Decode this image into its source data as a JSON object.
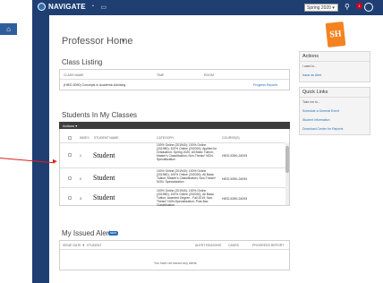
{
  "topbar": {
    "brand": "NAVIGATE",
    "icons": [
      "home-outline-icon",
      "bell-outline-icon",
      "document-outline-icon"
    ],
    "term_select": "Spring 2020",
    "notification_count": "1"
  },
  "sidebar": {
    "icons": [
      "home-icon",
      "mail-icon",
      "calendar-icon",
      "reports-icon",
      "chart-icon",
      "pin-icon",
      "search-icon",
      "tag-icon",
      "list-icon",
      "settings-icon"
    ]
  },
  "header": {
    "title": "Professor Home",
    "caret": "▾"
  },
  "logo_text": "SH",
  "class_listing": {
    "title": "Class Listing",
    "columns": [
      "CLASS NAME",
      "TIME",
      "ROOM"
    ],
    "rows": [
      {
        "class_name": "(HIED-5390) Concepts in Academic Advising",
        "time": "",
        "room": "",
        "action": "Progress Reports"
      }
    ]
  },
  "students": {
    "title": "Students In My Classes",
    "actions_label": "Actions ▾",
    "columns": [
      "INDEX",
      "STUDENT NAME",
      "CATEGORY",
      "COURSE(S)"
    ],
    "rows": [
      {
        "index": "1",
        "name": "Student",
        "category": "100% Online (201940); 100% Online (201980); 100% Online (202020); Applied for Graduation- Spring 2020; All Basic Tuition; Master's Classification; Non-Thesis* NON- Specialization",
        "course": "HIED-5390-24093"
      },
      {
        "index": "2",
        "name": "Student",
        "category": "100% Online (201940); 100% Online (201980); 100% Online (202020); All Basic Tuition; Master's Classification; Non-Thesis* NON- Specialization",
        "course": "HIED-5390-24093"
      },
      {
        "index": "3",
        "name": "Student",
        "category": "100% Online (201940); 100% Online (201980); 100% Online (202020); All Basic Tuition; Awarded Degree - Fall 2019; Non-Thesis* NON-Specialization; Post-Bac Classification",
        "course": "HIED-5390-24093"
      }
    ]
  },
  "issued_alerts": {
    "title": "My Issued Alerts",
    "badge": "NEW",
    "columns": [
      "ISSUE DATE ▼",
      "STUDENT",
      "ALERT REASONS",
      "CASES",
      "PROGRESS REPORT"
    ],
    "empty_message": "You have not issued any alerts."
  },
  "actions_panel": {
    "title": "Actions",
    "prompt": "I want to...",
    "link": "Issue an Alert"
  },
  "quick_links": {
    "title": "Quick Links",
    "prompt": "Take me to...",
    "links": [
      "Schedule a General Event",
      "Student Information",
      "Download Center for Reports"
    ]
  }
}
